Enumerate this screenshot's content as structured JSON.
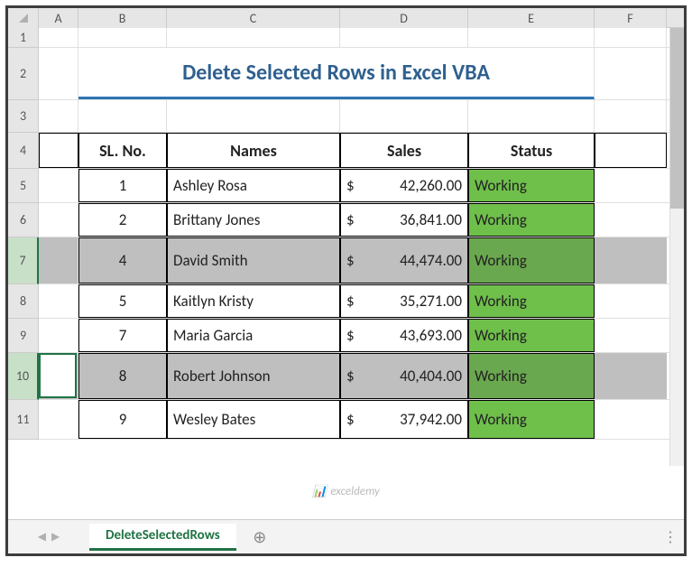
{
  "columns": [
    {
      "letter": "A",
      "w": 44
    },
    {
      "letter": "B",
      "w": 98
    },
    {
      "letter": "C",
      "w": 192
    },
    {
      "letter": "D",
      "w": 142
    },
    {
      "letter": "E",
      "w": 140
    },
    {
      "letter": "F",
      "w": 80
    }
  ],
  "rows": [
    {
      "n": "1",
      "h": 22,
      "sel": false
    },
    {
      "n": "2",
      "h": 58,
      "sel": false
    },
    {
      "n": "3",
      "h": 36,
      "sel": false
    },
    {
      "n": "4",
      "h": 40,
      "sel": false
    },
    {
      "n": "5",
      "h": 38,
      "sel": false
    },
    {
      "n": "6",
      "h": 38,
      "sel": false
    },
    {
      "n": "7",
      "h": 52,
      "sel": true
    },
    {
      "n": "8",
      "h": 38,
      "sel": false
    },
    {
      "n": "9",
      "h": 38,
      "sel": false
    },
    {
      "n": "10",
      "h": 52,
      "sel": true
    },
    {
      "n": "11",
      "h": 44,
      "sel": false
    }
  ],
  "title": "Delete Selected Rows in Excel VBA",
  "headers": {
    "sl": "SL. No.",
    "names": "Names",
    "sales": "Sales",
    "status": "Status"
  },
  "data_rows": [
    {
      "sl": "1",
      "name": "Ashley Rosa",
      "sales": "42,260.00",
      "status": "Working"
    },
    {
      "sl": "2",
      "name": "Brittany Jones",
      "sales": "36,841.00",
      "status": "Working"
    },
    {
      "sl": "4",
      "name": "David Smith",
      "sales": "44,474.00",
      "status": "Working"
    },
    {
      "sl": "5",
      "name": "Kaitlyn Kristy",
      "sales": "35,271.00",
      "status": "Working"
    },
    {
      "sl": "7",
      "name": "Maria Garcia",
      "sales": "43,693.00",
      "status": "Working"
    },
    {
      "sl": "8",
      "name": "Robert Johnson",
      "sales": "40,404.00",
      "status": "Working"
    },
    {
      "sl": "9",
      "name": "Wesley Bates",
      "sales": "37,942.00",
      "status": "Working"
    }
  ],
  "currency": "$",
  "tab": {
    "name": "DeleteSelectedRows"
  },
  "selected_data_idx": [
    2,
    5
  ],
  "active_cell": {
    "row_idx": 9,
    "col_idx": 0
  },
  "watermark": "exceldemy"
}
